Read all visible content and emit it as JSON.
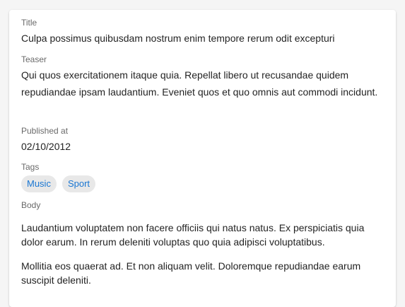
{
  "fields": {
    "title_label": "Title",
    "title_value": "Culpa possimus quibusdam nostrum enim tempore rerum odit excepturi",
    "teaser_label": "Teaser",
    "teaser_value": "Qui quos exercitationem itaque quia. Repellat libero ut recusandae quidem repudiandae ipsam laudantium. Eveniet quos et quo omnis aut commodi incidunt.",
    "published_label": "Published at",
    "published_value": "02/10/2012",
    "tags_label": "Tags",
    "tags": [
      "Music",
      "Sport"
    ],
    "body_label": "Body",
    "body_paragraphs": [
      "Laudantium voluptatem non facere officiis qui natus natus. Ex perspiciatis quia dolor earum. In rerum deleniti voluptas quo quia adipisci voluptatibus.",
      "Mollitia eos quaerat ad. Et non aliquam velit. Doloremque repudiandae earum suscipit deleniti."
    ]
  },
  "colors": {
    "chip_text": "#1976d2",
    "chip_background": "#e8e8e8",
    "label": "#757575"
  }
}
